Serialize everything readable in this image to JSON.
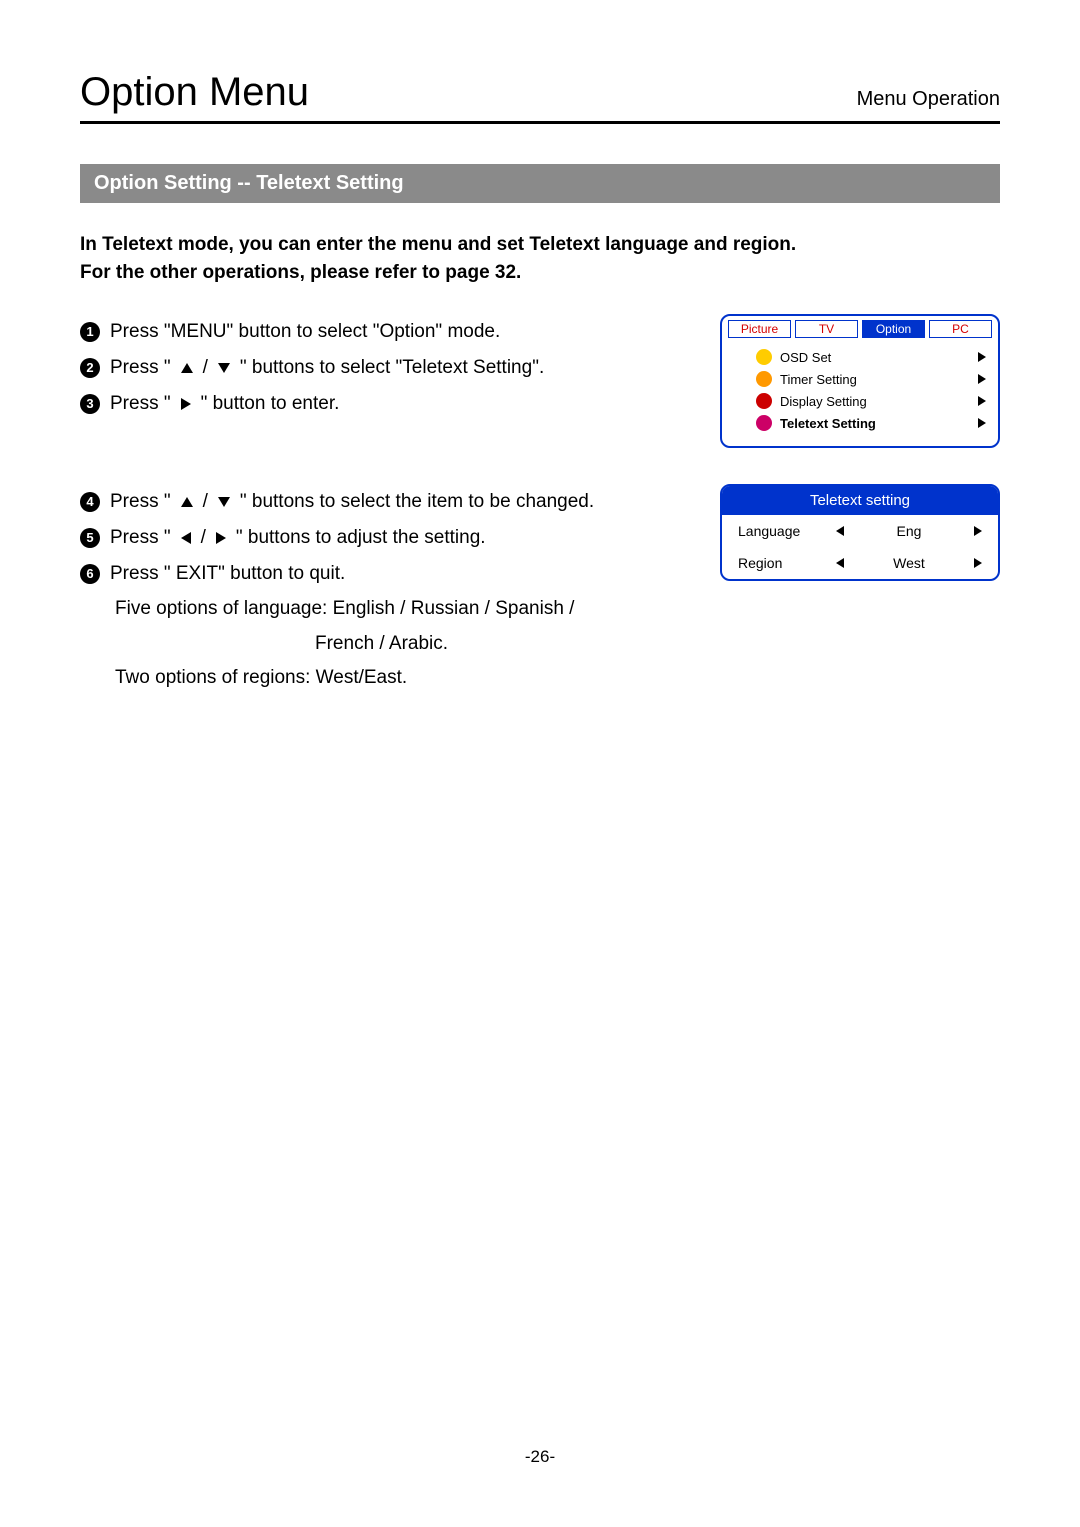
{
  "header": {
    "title": "Option Menu",
    "section_label": "Menu Operation"
  },
  "section_bar": "Option Setting -- Teletext Setting",
  "intro_line1": "In Teletext mode, you can enter the menu and set Teletext language and region.",
  "intro_line2": "For the other operations, please refer to page 32.",
  "steps_a": {
    "s1_a": "Press \"MENU\" button to select \"Option\" mode.",
    "s2_a": "Press \"",
    "s2_b": "\" buttons to select \"Teletext Setting\".",
    "s3_a": "Press \" ",
    "s3_b": " \" button to enter."
  },
  "steps_b": {
    "s4_a": "Press \"",
    "s4_b": "\" buttons to select the item to be changed.",
    "s5_a": "Press \" ",
    "s5_b": " \" buttons to adjust the setting.",
    "s6_a": "Press \" EXIT\" button to quit."
  },
  "notes": {
    "lang_a": "Five options of language: English / Russian / Spanish /",
    "lang_b": "French / Arabic.",
    "region": "Two options of regions: West/East."
  },
  "osd": {
    "tabs": {
      "t0": "Picture",
      "t1": "TV",
      "t2": "Option",
      "t3": "PC"
    },
    "items": {
      "i0": "OSD Set",
      "i1": "Timer Setting",
      "i2": "Display Setting",
      "i3": "Teletext Setting"
    }
  },
  "tele": {
    "title": "Teletext setting",
    "row0_label": "Language",
    "row0_value": "Eng",
    "row1_label": "Region",
    "row1_value": "West"
  },
  "page_number": "-26-"
}
